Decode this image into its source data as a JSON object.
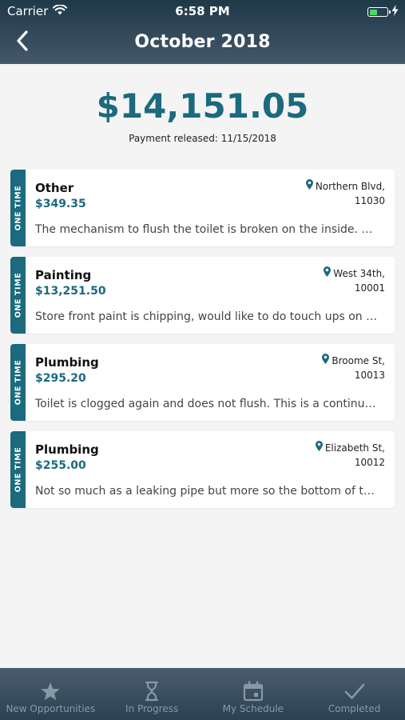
{
  "status_bar": {
    "carrier": "Carrier",
    "time": "6:58 PM"
  },
  "header": {
    "title": "October 2018"
  },
  "summary": {
    "total": "$14,151.05",
    "payment_released": "Payment released: 11/15/2018"
  },
  "jobs": [
    {
      "tab": "ONE TIME",
      "category": "Other",
      "amount": "$349.35",
      "street": "Northern Blvd,",
      "zip": "11030",
      "description": "The mechanism to flush the toilet is broken on the inside. We…"
    },
    {
      "tab": "ONE TIME",
      "category": "Painting",
      "amount": "$13,251.50",
      "street": "West 34th,",
      "zip": "10001",
      "description": "Store front paint is chipping, would like to do touch ups on all…"
    },
    {
      "tab": "ONE TIME",
      "category": "Plumbing",
      "amount": "$295.20",
      "street": "Broome St,",
      "zip": "10013",
      "description": "Toilet is clogged again and does not flush. This is a continued…"
    },
    {
      "tab": "ONE TIME",
      "category": "Plumbing",
      "amount": "$255.00",
      "street": "Elizabeth St,",
      "zip": "10012",
      "description": "Not so much as a leaking pipe but more so the bottom of the t…"
    }
  ],
  "tabbar": {
    "items": [
      {
        "label": "New Opportunities",
        "icon": "star-icon"
      },
      {
        "label": "In Progress",
        "icon": "hourglass-icon"
      },
      {
        "label": "My Schedule",
        "icon": "calendar-icon"
      },
      {
        "label": "Completed",
        "icon": "checkmark-icon"
      }
    ]
  },
  "colors": {
    "accent": "#1b6a7d",
    "header_top": "#1f3949",
    "header_bottom": "#44586a",
    "battery": "#4cd964",
    "tab_inactive": "#8899a6"
  }
}
